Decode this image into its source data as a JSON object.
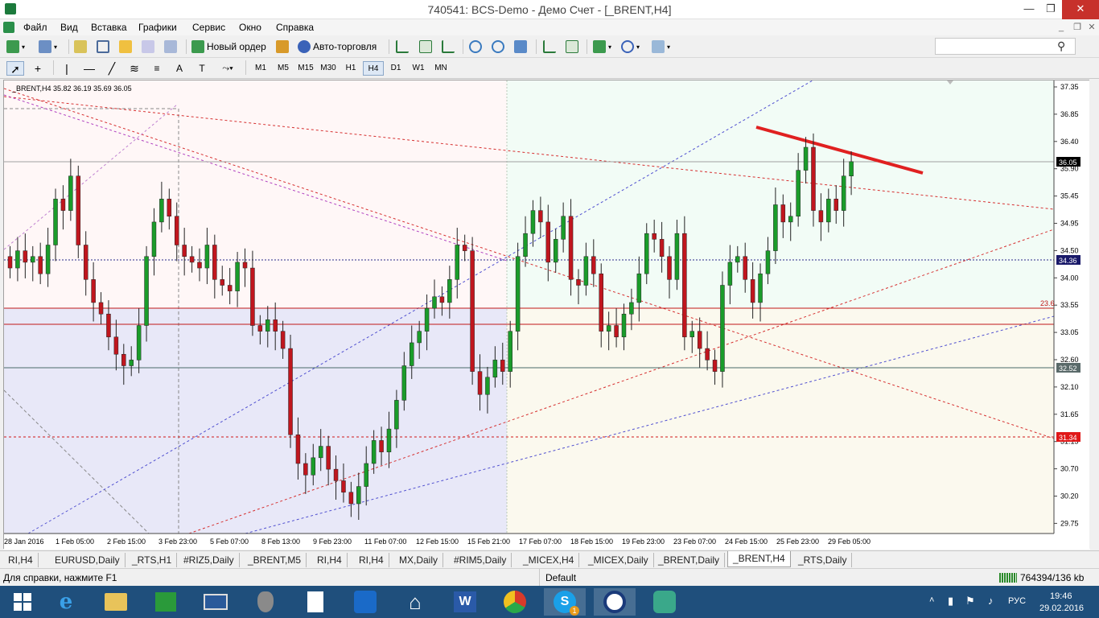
{
  "window": {
    "title": "740541: BCS-Demo - Демо Счет - [_BRENT,H4]"
  },
  "menu": [
    "Файл",
    "Вид",
    "Вставка",
    "Графики",
    "Сервис",
    "Окно",
    "Справка"
  ],
  "toolbar": {
    "new_order": "Новый ордер",
    "auto_trading": "Авто-торговля"
  },
  "timeframes": [
    "M1",
    "M5",
    "M15",
    "M30",
    "H1",
    "H4",
    "D1",
    "W1",
    "MN"
  ],
  "active_timeframe": "H4",
  "chart": {
    "header": "_BRENT,H4  35.82 36.19 35.69 36.05",
    "price_labels": [
      "37.35",
      "36.85",
      "36.40",
      "35.90",
      "35.45",
      "34.95",
      "34.50",
      "34.00",
      "33.55",
      "33.05",
      "32.60",
      "32.10",
      "31.65",
      "31.15",
      "30.70",
      "30.20",
      "29.75"
    ],
    "time_labels": [
      "28 Jan 2016",
      "1 Feb 05:00",
      "2 Feb 15:00",
      "3 Feb 23:00",
      "5 Feb 07:00",
      "8 Feb 13:00",
      "9 Feb 23:00",
      "11 Feb 07:00",
      "12 Feb 15:00",
      "15 Feb 21:00",
      "17 Feb 07:00",
      "18 Feb 15:00",
      "19 Feb 23:00",
      "23 Feb 07:00",
      "24 Feb 15:00",
      "25 Feb 23:00",
      "29 Feb 05:00"
    ],
    "current_price": "36.05",
    "level_blue": "34.36",
    "level_gray": "32.52",
    "level_red": "31.34",
    "fibo_label": "23.6",
    "colors": {
      "bull": "#1a9c2a",
      "bear": "#c0161e",
      "bg": "#ffffff",
      "zone_lavender": "#e6e6f8",
      "zone_pink": "#fff6f6",
      "zone_mint": "#f2fcf6",
      "zone_cream": "#fbf9ee"
    }
  },
  "tabs": [
    "RI,H4",
    "EURUSD,Daily",
    "_RTS,H1",
    "#RIZ5,Daily",
    "_BRENT,M5",
    "RI,H4",
    "RI,H4",
    "MX,Daily",
    "#RIM5,Daily",
    "_MICEX,H4",
    "_MICEX,Daily",
    "_BRENT,Daily",
    "_BRENT,H4",
    "_RTS,Daily"
  ],
  "active_tab": 12,
  "status": {
    "help": "Для справки, нажмите F1",
    "profile": "Default",
    "traffic": "764394/136 kb"
  },
  "taskbar": {
    "lang": "РУС",
    "time": "19:46",
    "date": "29.02.2016",
    "skype_badge": "1"
  }
}
